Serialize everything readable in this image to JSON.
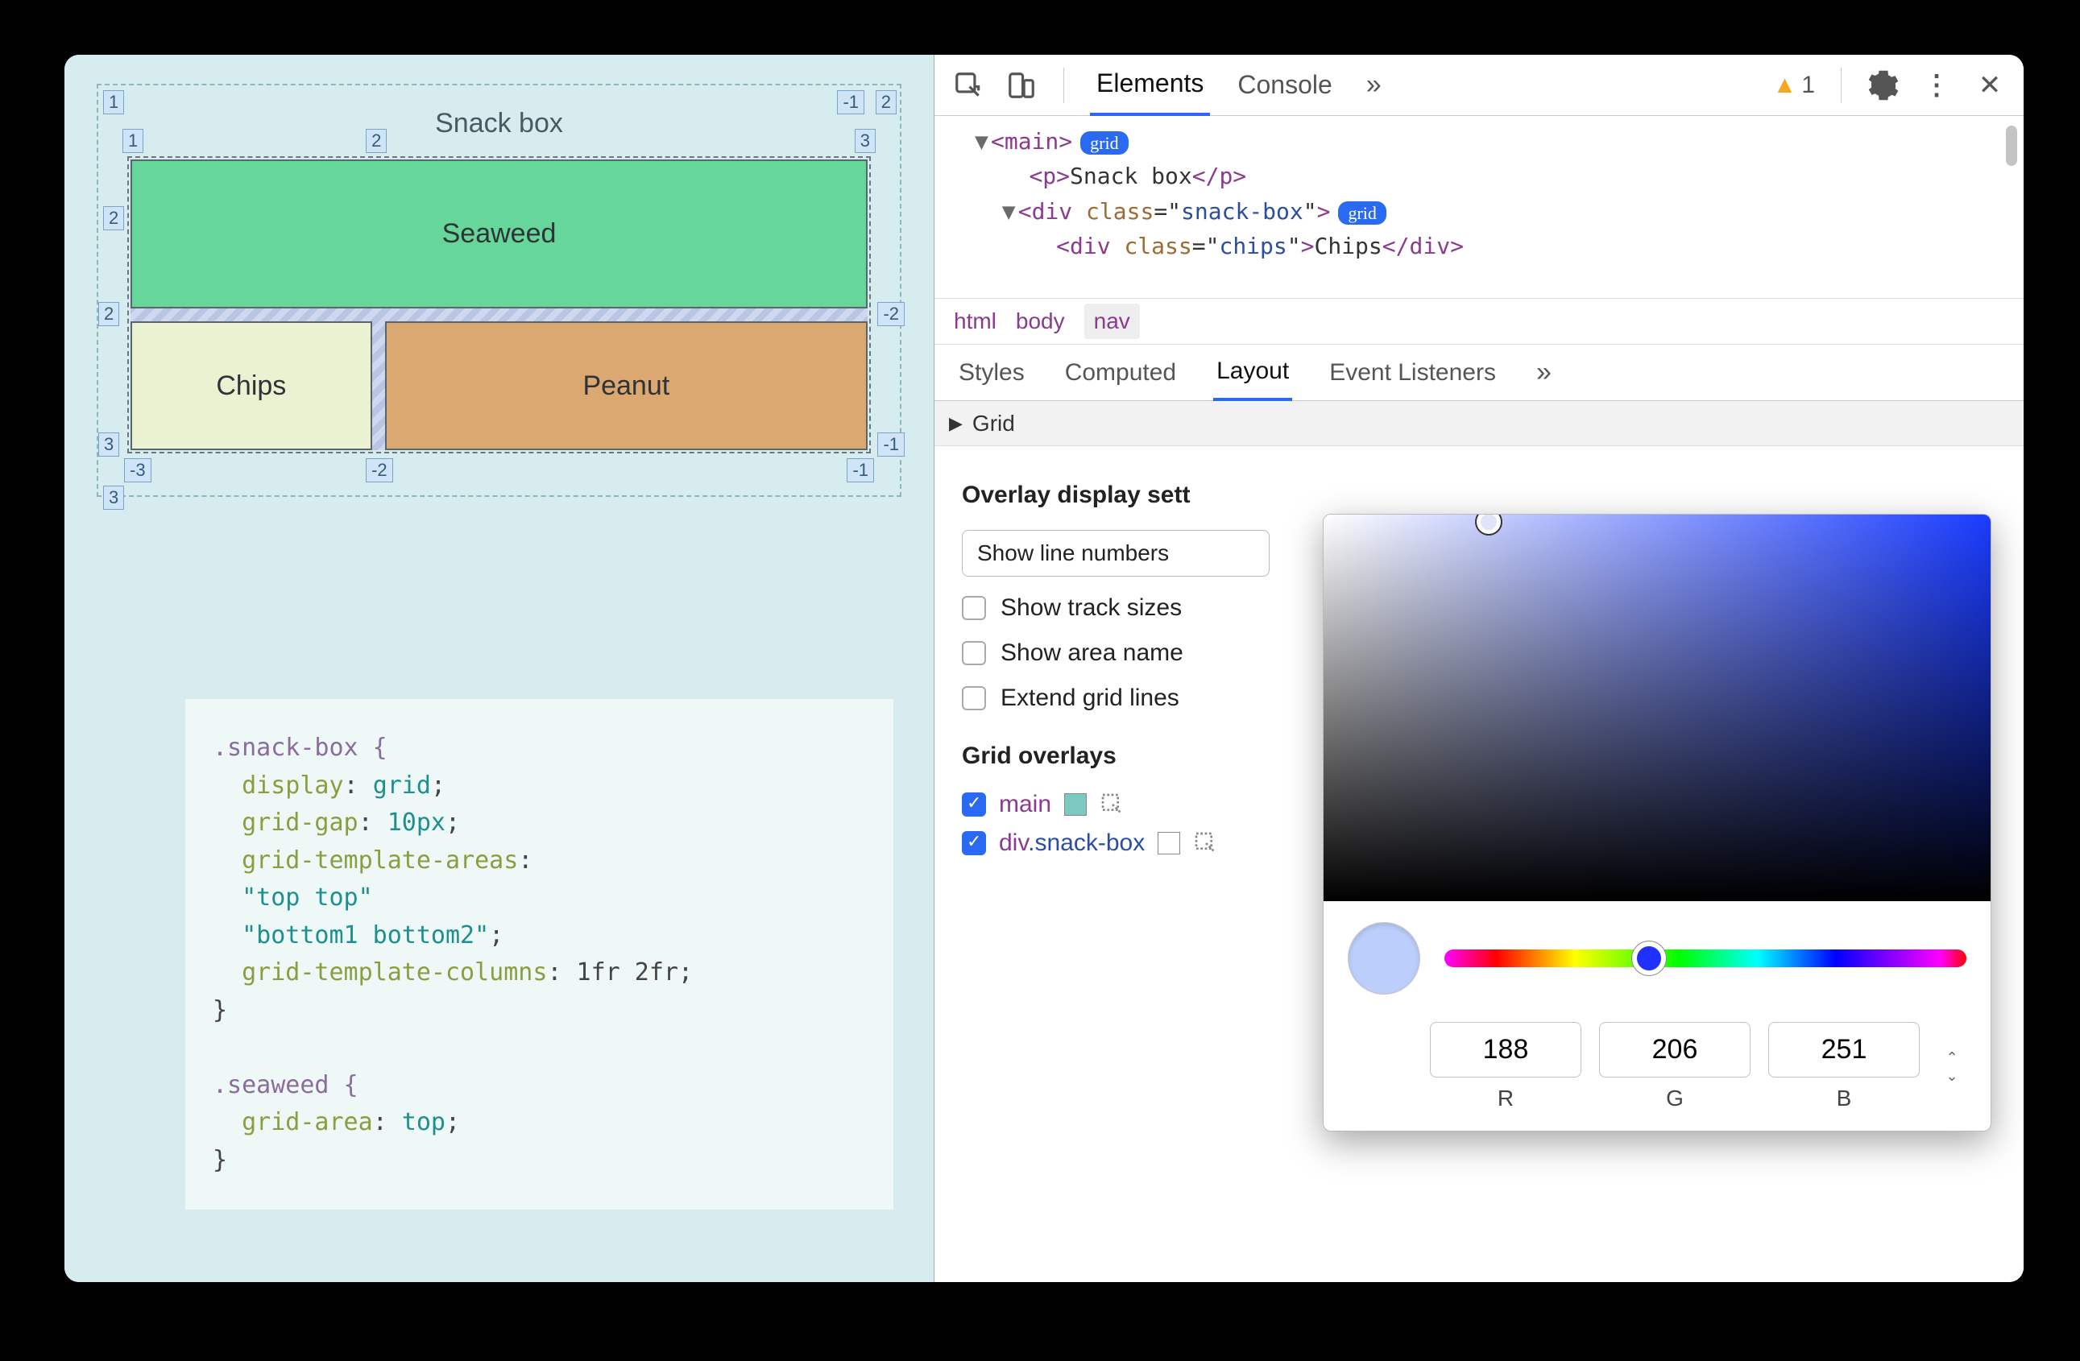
{
  "page": {
    "title": "Snack box"
  },
  "grid_cells": {
    "seaweed": "Seaweed",
    "chips": "Chips",
    "peanut": "Peanut"
  },
  "line_nums": {
    "outer_tl": "1",
    "outer_tr_neg": "-1",
    "outer_tr": "2",
    "outer_left": "2",
    "outer_bl": "3",
    "in_tl": "1",
    "in_tm": "2",
    "in_tr": "3",
    "in_ml": "2",
    "in_mr": "-2",
    "in_bl": "3",
    "in_bm_l": "-3",
    "in_bm_m": "-2",
    "in_br": "-1",
    "in_br2": "-1"
  },
  "code": {
    "l1": ".snack-box {",
    "l2_p": "display",
    "l2_v": "grid",
    "l3_p": "grid-gap",
    "l3_v": "10px",
    "l4_p": "grid-template-areas",
    "l5": "\"top top\"",
    "l6": "\"bottom1 bottom2\"",
    "l7_p": "grid-template-columns",
    "l7_v": "1fr 2fr",
    "l8": "}",
    "l9": "",
    "l10": ".seaweed {",
    "l11_p": "grid-area",
    "l11_v": "top",
    "l12": "}"
  },
  "toolbar": {
    "tabs": {
      "elements": "Elements",
      "console": "Console"
    },
    "warn_count": "1"
  },
  "dom": {
    "l1_tag": "main",
    "l1_badge": "grid",
    "l2": "<p>Snack box</p>",
    "l3_open": "<div ",
    "l3_attr": "class",
    "l3_val": "snack-box",
    "l3_close": ">",
    "l3_badge": "grid",
    "l4_open": "<div ",
    "l4_attr": "class",
    "l4_val": "chips",
    "l4_close": ">Chips</div>"
  },
  "crumbs": {
    "a": "html",
    "b": "body",
    "c": "nav"
  },
  "subtabs": {
    "styles": "Styles",
    "computed": "Computed",
    "layout": "Layout",
    "events": "Event Listeners"
  },
  "grid_section": {
    "head": "Grid",
    "heading": "Overlay display sett",
    "dropdown": "Show line numbers",
    "chk_track": "Show track sizes",
    "chk_area": "Show area name",
    "chk_extend": "Extend grid lines",
    "overlays_head": "Grid overlays",
    "ov1": "main",
    "ov2a": "div",
    "ov2b": ".snack-box"
  },
  "picker": {
    "r": "188",
    "g": "206",
    "b": "251",
    "lbl_r": "R",
    "lbl_g": "G",
    "lbl_b": "B",
    "preview": "#bccefb",
    "swatch_main": "#7bc9c1"
  }
}
